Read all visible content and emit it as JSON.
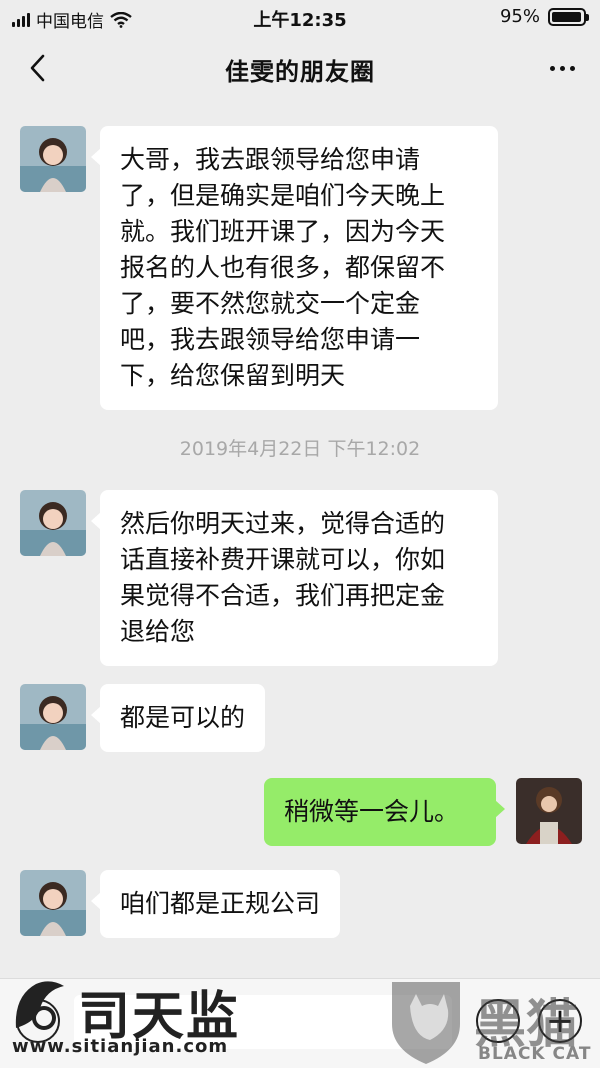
{
  "status_bar": {
    "carrier": "中国电信",
    "time": "上午12:35",
    "battery_percent": "95%",
    "battery_level": 0.95
  },
  "nav": {
    "title": "佳雯的朋友圈",
    "back_icon": "chevron-left-icon",
    "more_icon": "more-dots-icon"
  },
  "messages": [
    {
      "side": "left",
      "text_lines": [
        "大哥，我去跟领导给您申请",
        "了，但是确实是咱们今天晚上",
        "就。我们班开课了，因为今天",
        "报名的人也有很多，都保留不",
        "了，要不然您就交一个定金",
        "吧，我去跟领导给您申请一",
        "下，给您保留到明天"
      ]
    },
    {
      "side": "left",
      "text_lines": [
        "然后你明天过来，觉得合适的",
        "话直接补费开课就可以，你如",
        "果觉得不合适，我们再把定金",
        "退给您"
      ]
    },
    {
      "side": "left",
      "text_lines": [
        "都是可以的"
      ]
    },
    {
      "side": "right",
      "text_lines": [
        "稍微等一会儿。"
      ]
    },
    {
      "side": "left",
      "text_lines": [
        "咱们都是正规公司"
      ]
    }
  ],
  "timestamp": "2019年4月22日 下午12:02",
  "watermarks": {
    "left_brand": "司天监",
    "left_url": "www.sitianjian.com",
    "right_brand": "黑猫",
    "right_sub": "BLACK CAT"
  },
  "colors": {
    "background": "#ededed",
    "bubble_left": "#ffffff",
    "bubble_right": "#95ec69",
    "timestamp": "#a8a8a8"
  }
}
